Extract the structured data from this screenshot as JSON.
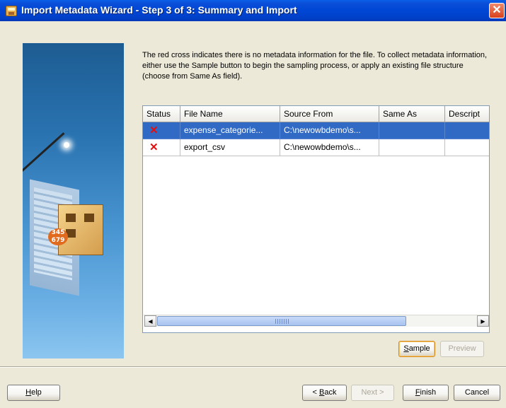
{
  "window": {
    "title": "Import Metadata Wizard - Step 3 of 3: Summary and Import",
    "close_glyph": "✕"
  },
  "description": "The red cross indicates there is no metadata information for the file. To collect metadata information, either use the Sample button to begin the sampling process, or apply an existing file structure (choose from Same As field).",
  "table": {
    "columns": [
      "Status",
      "File Name",
      "Source From",
      "Same As",
      "Descript"
    ],
    "rows": [
      {
        "status_icon": "red-cross-icon",
        "status": "✕",
        "file_name": "expense_categorie...",
        "source_from": "C:\\newowbdemo\\s...",
        "same_as": "",
        "description": "",
        "selected": true
      },
      {
        "status_icon": "red-cross-icon",
        "status": "✕",
        "file_name": "export_csv",
        "source_from": "C:\\newowbdemo\\s...",
        "same_as": "",
        "description": "",
        "selected": false
      }
    ]
  },
  "scrollbar": {
    "left_arrow": "◀",
    "right_arrow": "▶"
  },
  "buttons": {
    "sample": {
      "mnemonic": "S",
      "rest": "ample"
    },
    "preview": {
      "label": "Preview"
    },
    "help": {
      "mnemonic": "H",
      "rest": "elp"
    },
    "back": {
      "prefix": "< ",
      "mnemonic": "B",
      "rest": "ack"
    },
    "next": {
      "label": "Next >"
    },
    "finish": {
      "mnemonic": "F",
      "rest": "inish"
    },
    "cancel": {
      "label": "Cancel"
    }
  },
  "side_image": {
    "badge_text": "345\n679"
  },
  "colors": {
    "selection": "#316AC5",
    "status_cross": "#E01010",
    "title_bar": "#0046D5"
  }
}
